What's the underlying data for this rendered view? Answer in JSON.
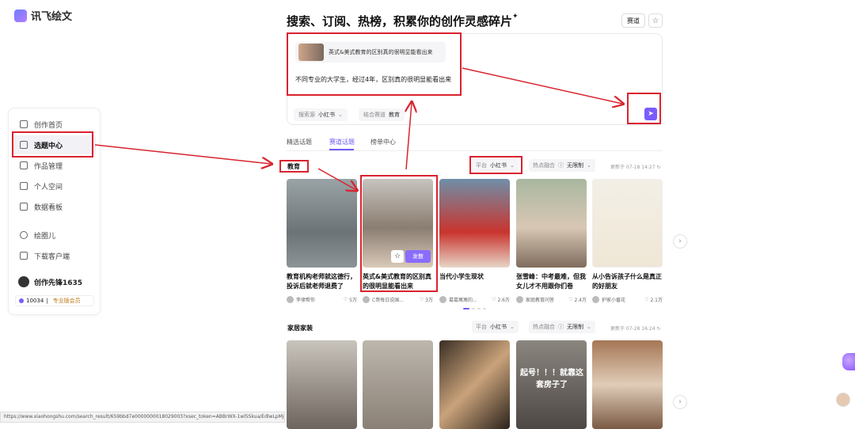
{
  "brand": {
    "name": "讯飞绘文"
  },
  "sidebar": {
    "items": [
      {
        "label": "创作首页",
        "icon": "home-icon"
      },
      {
        "label": "选题中心",
        "icon": "target-icon"
      },
      {
        "label": "作品管理",
        "icon": "document-icon"
      },
      {
        "label": "个人空间",
        "icon": "folder-icon"
      },
      {
        "label": "数据看板",
        "icon": "chart-icon"
      },
      {
        "label": "绘圈儿",
        "icon": "circle-icon"
      },
      {
        "label": "下载客户端",
        "icon": "monitor-icon"
      }
    ],
    "user": {
      "name": "创作先锋1635",
      "points": "10034",
      "vip": "专业版会员"
    }
  },
  "header": {
    "title": "搜索、订阅、热榜，积累你的创作灵感碎片",
    "track_button": "赛道"
  },
  "prompt_panel": {
    "chip_title": "英式&美式教育的区别真的很明显能看出来",
    "text": "不同专业的大学生，经过4年，区别真的很明显能看出来",
    "source_label": "搜索源",
    "source_value": "小红书",
    "mix_label": "结合赛道",
    "mix_value": "教育"
  },
  "tabs": [
    {
      "label": "精选话题"
    },
    {
      "label": "赛道话题"
    },
    {
      "label": "榜单中心"
    }
  ],
  "sections": [
    {
      "title": "教育",
      "platform_label": "平台",
      "platform_value": "小红书",
      "hot_label": "热点融合",
      "hot_value": "无限制",
      "updated": "更新于 07-18 14:27",
      "cards": [
        {
          "title": "教育机构老师就这德行，投诉后就老师退费了",
          "author": "李律帮你",
          "likes": "5万"
        },
        {
          "title": "英式&美式教育的区别真的很明显能看出来",
          "author": "C哥每日说国...",
          "likes": "3万"
        },
        {
          "title": "当代小学生现状",
          "author": "葛葛寓寓的...",
          "likes": "2.6万"
        },
        {
          "title": "张雪峰：中考最难，但我女儿才不用跟你们卷",
          "author": "家庭教育问答",
          "likes": "2.4万"
        },
        {
          "title": "从小告诉孩子什么是真正的好朋友",
          "author": "护家小番花",
          "likes": "2.1万"
        }
      ],
      "card_fav": "☆",
      "card_post": "发散"
    },
    {
      "title": "家居家装",
      "platform_label": "平台",
      "platform_value": "小红书",
      "hot_label": "热点融合",
      "hot_value": "无限制",
      "updated": "更新于 07-28 16:24",
      "cards": [
        {},
        {},
        {},
        {
          "overlay": "起号！！！就靠这套房子了"
        },
        {}
      ]
    }
  ],
  "status_url": "https://www.xiaohongshu.com/search_result/659bbd7e0000000018029003?xsec_token=ABBrWX-1wl5Skua/EdlwLpMjdD_Hu...",
  "colors": {
    "accent": "#6e5cf5",
    "annotation": "#d9232e"
  }
}
